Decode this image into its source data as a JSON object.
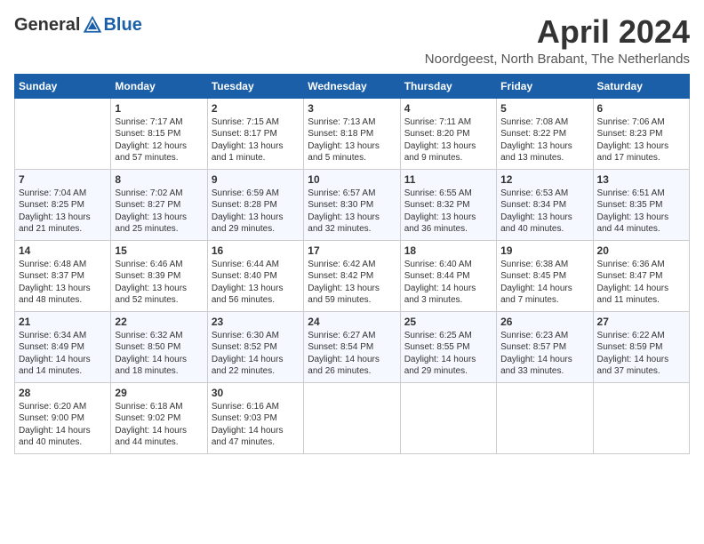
{
  "header": {
    "logo_general": "General",
    "logo_blue": "Blue",
    "month_title": "April 2024",
    "location": "Noordgeest, North Brabant, The Netherlands"
  },
  "days_of_week": [
    "Sunday",
    "Monday",
    "Tuesday",
    "Wednesday",
    "Thursday",
    "Friday",
    "Saturday"
  ],
  "weeks": [
    [
      {
        "day": "",
        "sunrise": "",
        "sunset": "",
        "daylight": ""
      },
      {
        "day": "1",
        "sunrise": "Sunrise: 7:17 AM",
        "sunset": "Sunset: 8:15 PM",
        "daylight": "Daylight: 12 hours and 57 minutes."
      },
      {
        "day": "2",
        "sunrise": "Sunrise: 7:15 AM",
        "sunset": "Sunset: 8:17 PM",
        "daylight": "Daylight: 13 hours and 1 minute."
      },
      {
        "day": "3",
        "sunrise": "Sunrise: 7:13 AM",
        "sunset": "Sunset: 8:18 PM",
        "daylight": "Daylight: 13 hours and 5 minutes."
      },
      {
        "day": "4",
        "sunrise": "Sunrise: 7:11 AM",
        "sunset": "Sunset: 8:20 PM",
        "daylight": "Daylight: 13 hours and 9 minutes."
      },
      {
        "day": "5",
        "sunrise": "Sunrise: 7:08 AM",
        "sunset": "Sunset: 8:22 PM",
        "daylight": "Daylight: 13 hours and 13 minutes."
      },
      {
        "day": "6",
        "sunrise": "Sunrise: 7:06 AM",
        "sunset": "Sunset: 8:23 PM",
        "daylight": "Daylight: 13 hours and 17 minutes."
      }
    ],
    [
      {
        "day": "7",
        "sunrise": "Sunrise: 7:04 AM",
        "sunset": "Sunset: 8:25 PM",
        "daylight": "Daylight: 13 hours and 21 minutes."
      },
      {
        "day": "8",
        "sunrise": "Sunrise: 7:02 AM",
        "sunset": "Sunset: 8:27 PM",
        "daylight": "Daylight: 13 hours and 25 minutes."
      },
      {
        "day": "9",
        "sunrise": "Sunrise: 6:59 AM",
        "sunset": "Sunset: 8:28 PM",
        "daylight": "Daylight: 13 hours and 29 minutes."
      },
      {
        "day": "10",
        "sunrise": "Sunrise: 6:57 AM",
        "sunset": "Sunset: 8:30 PM",
        "daylight": "Daylight: 13 hours and 32 minutes."
      },
      {
        "day": "11",
        "sunrise": "Sunrise: 6:55 AM",
        "sunset": "Sunset: 8:32 PM",
        "daylight": "Daylight: 13 hours and 36 minutes."
      },
      {
        "day": "12",
        "sunrise": "Sunrise: 6:53 AM",
        "sunset": "Sunset: 8:34 PM",
        "daylight": "Daylight: 13 hours and 40 minutes."
      },
      {
        "day": "13",
        "sunrise": "Sunrise: 6:51 AM",
        "sunset": "Sunset: 8:35 PM",
        "daylight": "Daylight: 13 hours and 44 minutes."
      }
    ],
    [
      {
        "day": "14",
        "sunrise": "Sunrise: 6:48 AM",
        "sunset": "Sunset: 8:37 PM",
        "daylight": "Daylight: 13 hours and 48 minutes."
      },
      {
        "day": "15",
        "sunrise": "Sunrise: 6:46 AM",
        "sunset": "Sunset: 8:39 PM",
        "daylight": "Daylight: 13 hours and 52 minutes."
      },
      {
        "day": "16",
        "sunrise": "Sunrise: 6:44 AM",
        "sunset": "Sunset: 8:40 PM",
        "daylight": "Daylight: 13 hours and 56 minutes."
      },
      {
        "day": "17",
        "sunrise": "Sunrise: 6:42 AM",
        "sunset": "Sunset: 8:42 PM",
        "daylight": "Daylight: 13 hours and 59 minutes."
      },
      {
        "day": "18",
        "sunrise": "Sunrise: 6:40 AM",
        "sunset": "Sunset: 8:44 PM",
        "daylight": "Daylight: 14 hours and 3 minutes."
      },
      {
        "day": "19",
        "sunrise": "Sunrise: 6:38 AM",
        "sunset": "Sunset: 8:45 PM",
        "daylight": "Daylight: 14 hours and 7 minutes."
      },
      {
        "day": "20",
        "sunrise": "Sunrise: 6:36 AM",
        "sunset": "Sunset: 8:47 PM",
        "daylight": "Daylight: 14 hours and 11 minutes."
      }
    ],
    [
      {
        "day": "21",
        "sunrise": "Sunrise: 6:34 AM",
        "sunset": "Sunset: 8:49 PM",
        "daylight": "Daylight: 14 hours and 14 minutes."
      },
      {
        "day": "22",
        "sunrise": "Sunrise: 6:32 AM",
        "sunset": "Sunset: 8:50 PM",
        "daylight": "Daylight: 14 hours and 18 minutes."
      },
      {
        "day": "23",
        "sunrise": "Sunrise: 6:30 AM",
        "sunset": "Sunset: 8:52 PM",
        "daylight": "Daylight: 14 hours and 22 minutes."
      },
      {
        "day": "24",
        "sunrise": "Sunrise: 6:27 AM",
        "sunset": "Sunset: 8:54 PM",
        "daylight": "Daylight: 14 hours and 26 minutes."
      },
      {
        "day": "25",
        "sunrise": "Sunrise: 6:25 AM",
        "sunset": "Sunset: 8:55 PM",
        "daylight": "Daylight: 14 hours and 29 minutes."
      },
      {
        "day": "26",
        "sunrise": "Sunrise: 6:23 AM",
        "sunset": "Sunset: 8:57 PM",
        "daylight": "Daylight: 14 hours and 33 minutes."
      },
      {
        "day": "27",
        "sunrise": "Sunrise: 6:22 AM",
        "sunset": "Sunset: 8:59 PM",
        "daylight": "Daylight: 14 hours and 37 minutes."
      }
    ],
    [
      {
        "day": "28",
        "sunrise": "Sunrise: 6:20 AM",
        "sunset": "Sunset: 9:00 PM",
        "daylight": "Daylight: 14 hours and 40 minutes."
      },
      {
        "day": "29",
        "sunrise": "Sunrise: 6:18 AM",
        "sunset": "Sunset: 9:02 PM",
        "daylight": "Daylight: 14 hours and 44 minutes."
      },
      {
        "day": "30",
        "sunrise": "Sunrise: 6:16 AM",
        "sunset": "Sunset: 9:03 PM",
        "daylight": "Daylight: 14 hours and 47 minutes."
      },
      {
        "day": "",
        "sunrise": "",
        "sunset": "",
        "daylight": ""
      },
      {
        "day": "",
        "sunrise": "",
        "sunset": "",
        "daylight": ""
      },
      {
        "day": "",
        "sunrise": "",
        "sunset": "",
        "daylight": ""
      },
      {
        "day": "",
        "sunrise": "",
        "sunset": "",
        "daylight": ""
      }
    ]
  ]
}
